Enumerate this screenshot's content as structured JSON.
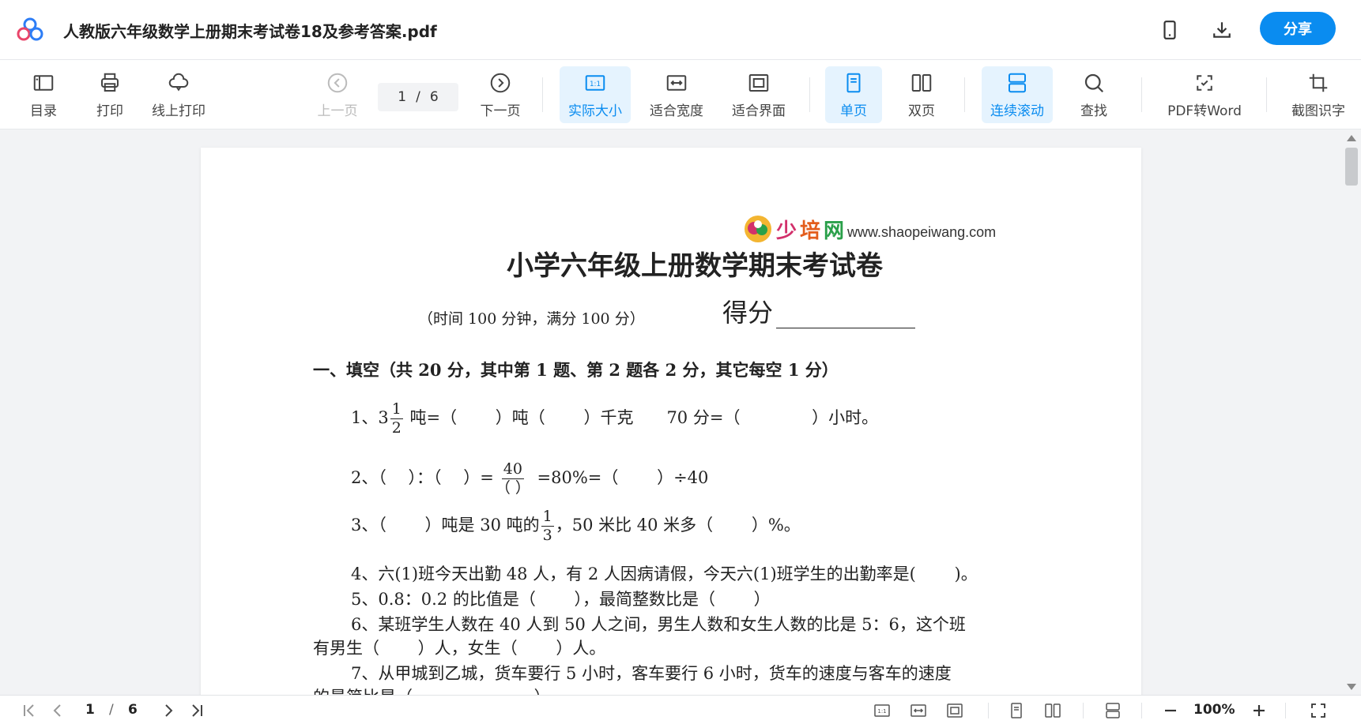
{
  "header": {
    "title": "人教版六年级数学上册期末考试卷18及参考答案.pdf",
    "share_label": "分享"
  },
  "toolbar": {
    "toc": "目录",
    "print": "打印",
    "online_print": "线上打印",
    "prev_page": "上一页",
    "current_page": "1",
    "page_sep": "/",
    "total_pages": "6",
    "next_page": "下一页",
    "actual_size": "实际大小",
    "fit_width": "适合宽度",
    "fit_window": "适合界面",
    "single_page": "单页",
    "double_page": "双页",
    "continuous": "连续滚动",
    "find": "查找",
    "pdf_to_word": "PDF转Word",
    "ocr": "截图识字"
  },
  "document": {
    "site_name_a": "少",
    "site_name_b": "培",
    "site_name_c": "网",
    "site_url": "www.shaopeiwang.com",
    "title": "小学六年级上册数学期末考试卷",
    "subtitle": "（时间 100 分钟，满分 100 分）",
    "score_label": "得分",
    "section1": "一、填空（共 20 分，其中第 1 题、第 2 题各 2 分，其它每空 1 分）",
    "q1_a": "1、3",
    "q1_frac_num": "1",
    "q1_frac_den": "2",
    "q1_b": " 吨=（　　 ）吨（　　 ）千克　　70 分=（　　　　 ）小时。",
    "q2_a": "2、（　 ）：（　 ）=",
    "q2_frac_num": "40",
    "q2_frac_den": "（ ）",
    "q2_b": " =80%=（　　 ）÷40",
    "q3_a": "3、（　　 ）吨是 30 吨的",
    "q3_frac_num": "1",
    "q3_frac_den": "3",
    "q3_b": "，50 米比 40 米多（　　 ）%。",
    "q4": "4、六(1)班今天出勤 48 人，有 2 人因病请假，今天六(1)班学生的出勤率是(　　 )。",
    "q5": "5、0.8：0.2 的比值是（　　 ），最简整数比是（　　 ）",
    "q6_a": "6、某班学生人数在 40 人到 50 人之间，男生人数和女生人数的比是 5：6，这个班",
    "q6_b": "有男生（　　 ）人，女生（　　 ）人。",
    "q7_a": "7、从甲城到乙城，货车要行 5 小时，客车要行 6 小时，货车的速度与客车的速度",
    "q7_b": "的最简比是（　　　　　　　 ）。"
  },
  "statusbar": {
    "current_page": "1",
    "page_sep": "/",
    "total_pages": "6",
    "zoom": "100%"
  },
  "colors": {
    "accent": "#0a8cf0",
    "active_bg": "#e5f3fe"
  }
}
